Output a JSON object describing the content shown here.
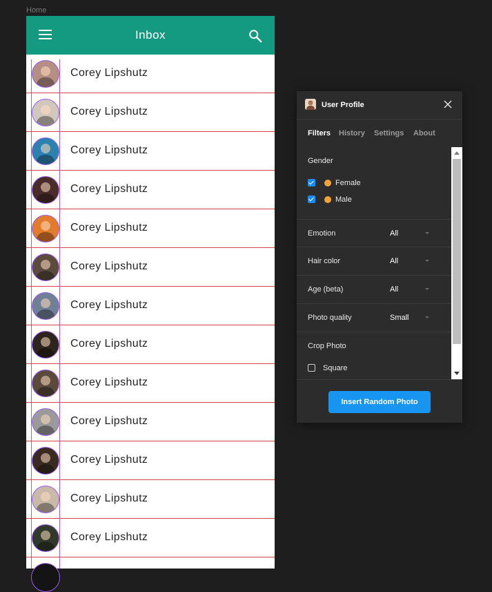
{
  "frame_label": "Home",
  "app": {
    "title": "Inbox",
    "menu_icon": "menu-icon",
    "search_icon": "search-icon",
    "accent_color": "#149a80",
    "divider_color": "#d8434a",
    "selection_color": "#9b59f0"
  },
  "contacts": [
    {
      "name": "Corey Lipshutz",
      "avatar_bg": "#b58f83"
    },
    {
      "name": "Corey Lipshutz",
      "avatar_bg": "#d2c7bd"
    },
    {
      "name": "Corey Lipshutz",
      "avatar_bg": "#2b82b0"
    },
    {
      "name": "Corey Lipshutz",
      "avatar_bg": "#4a2c2a"
    },
    {
      "name": "Corey Lipshutz",
      "avatar_bg": "#e37b2c"
    },
    {
      "name": "Corey Lipshutz",
      "avatar_bg": "#5a4b3e"
    },
    {
      "name": "Corey Lipshutz",
      "avatar_bg": "#6f7f95"
    },
    {
      "name": "Corey Lipshutz",
      "avatar_bg": "#2d241d"
    },
    {
      "name": "Corey Lipshutz",
      "avatar_bg": "#5b4a3c"
    },
    {
      "name": "Corey Lipshutz",
      "avatar_bg": "#9a9a9a"
    },
    {
      "name": "Corey Lipshutz",
      "avatar_bg": "#3a2b22"
    },
    {
      "name": "Corey Lipshutz",
      "avatar_bg": "#c8b9a9"
    },
    {
      "name": "Corey Lipshutz",
      "avatar_bg": "#2f3a2b"
    }
  ],
  "panel": {
    "title": "User Profile",
    "close_icon": "close-icon",
    "tabs": [
      {
        "label": "Filters",
        "active": true
      },
      {
        "label": "History",
        "active": false
      },
      {
        "label": "Settings",
        "active": false
      },
      {
        "label": "About",
        "active": false
      }
    ],
    "gender": {
      "title": "Gender",
      "options": [
        {
          "label": "Female",
          "checked": true,
          "emoji_icon": "woman-emoji-icon"
        },
        {
          "label": "Male",
          "checked": true,
          "emoji_icon": "man-emoji-icon"
        }
      ]
    },
    "filters": [
      {
        "label": "Emotion",
        "value": "All"
      },
      {
        "label": "Hair color",
        "value": "All"
      },
      {
        "label": "Age (beta)",
        "value": "All"
      },
      {
        "label": "Photo quality",
        "value": "Small"
      }
    ],
    "crop": {
      "title": "Crop Photo",
      "option_label": "Square",
      "checked": false
    },
    "insert_button": "Insert Random Photo",
    "button_color": "#1895f0"
  }
}
